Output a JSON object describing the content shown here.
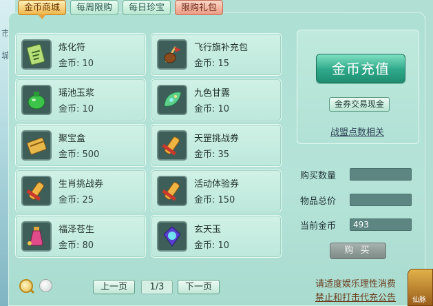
{
  "left_strip": {
    "chars": [
      "市",
      "城"
    ]
  },
  "tabs": [
    {
      "label": "金币商城",
      "active": true
    },
    {
      "label": "每周限购",
      "active": false
    },
    {
      "label": "每日珍宝",
      "active": false
    },
    {
      "label": "限购礼包",
      "active": false
    }
  ],
  "items": [
    {
      "name": "炼化符",
      "price_label": "金币: 10",
      "icon": "talisman-icon"
    },
    {
      "name": "飞行旗补充包",
      "price_label": "金币: 15",
      "icon": "flag-pack-icon"
    },
    {
      "name": "瑶池玉浆",
      "price_label": "金币: 10",
      "icon": "jade-potion-icon"
    },
    {
      "name": "九色甘露",
      "price_label": "金币: 10",
      "icon": "nectar-leaf-icon"
    },
    {
      "name": "聚宝盒",
      "price_label": "金币: 500",
      "icon": "treasure-box-icon"
    },
    {
      "name": "天罡挑战券",
      "price_label": "金币: 35",
      "icon": "scroll-icon"
    },
    {
      "name": "生肖挑战券",
      "price_label": "金币: 25",
      "icon": "scroll-icon"
    },
    {
      "name": "活动体验券",
      "price_label": "金币: 150",
      "icon": "scroll-icon"
    },
    {
      "name": "福泽苍生",
      "price_label": "金币: 80",
      "icon": "fortune-bottle-icon"
    },
    {
      "name": "玄天玉",
      "price_label": "金币: 10",
      "icon": "mystic-jade-icon"
    }
  ],
  "sidebar": {
    "recharge_label": "金币充值",
    "exchange_label": "金券交易现金",
    "alliance_link": "战盟点数相关",
    "quantity_label": "购买数量",
    "quantity_value": "",
    "total_label": "物品总价",
    "total_value": "",
    "current_label": "当前金币",
    "current_value": "493",
    "buy_label": "购 买"
  },
  "pagination": {
    "prev_label": "上一页",
    "page_text": "1/3",
    "next_label": "下一页"
  },
  "notice": {
    "line1": "请适度娱乐理性消费",
    "line2": "禁止和打击代充公告"
  },
  "corner": {
    "label": "仙脉"
  },
  "colors": {
    "accent_gold": "#f0b64b",
    "teal_button": "#2fa98a",
    "panel_bg": "#b2dfd4"
  }
}
